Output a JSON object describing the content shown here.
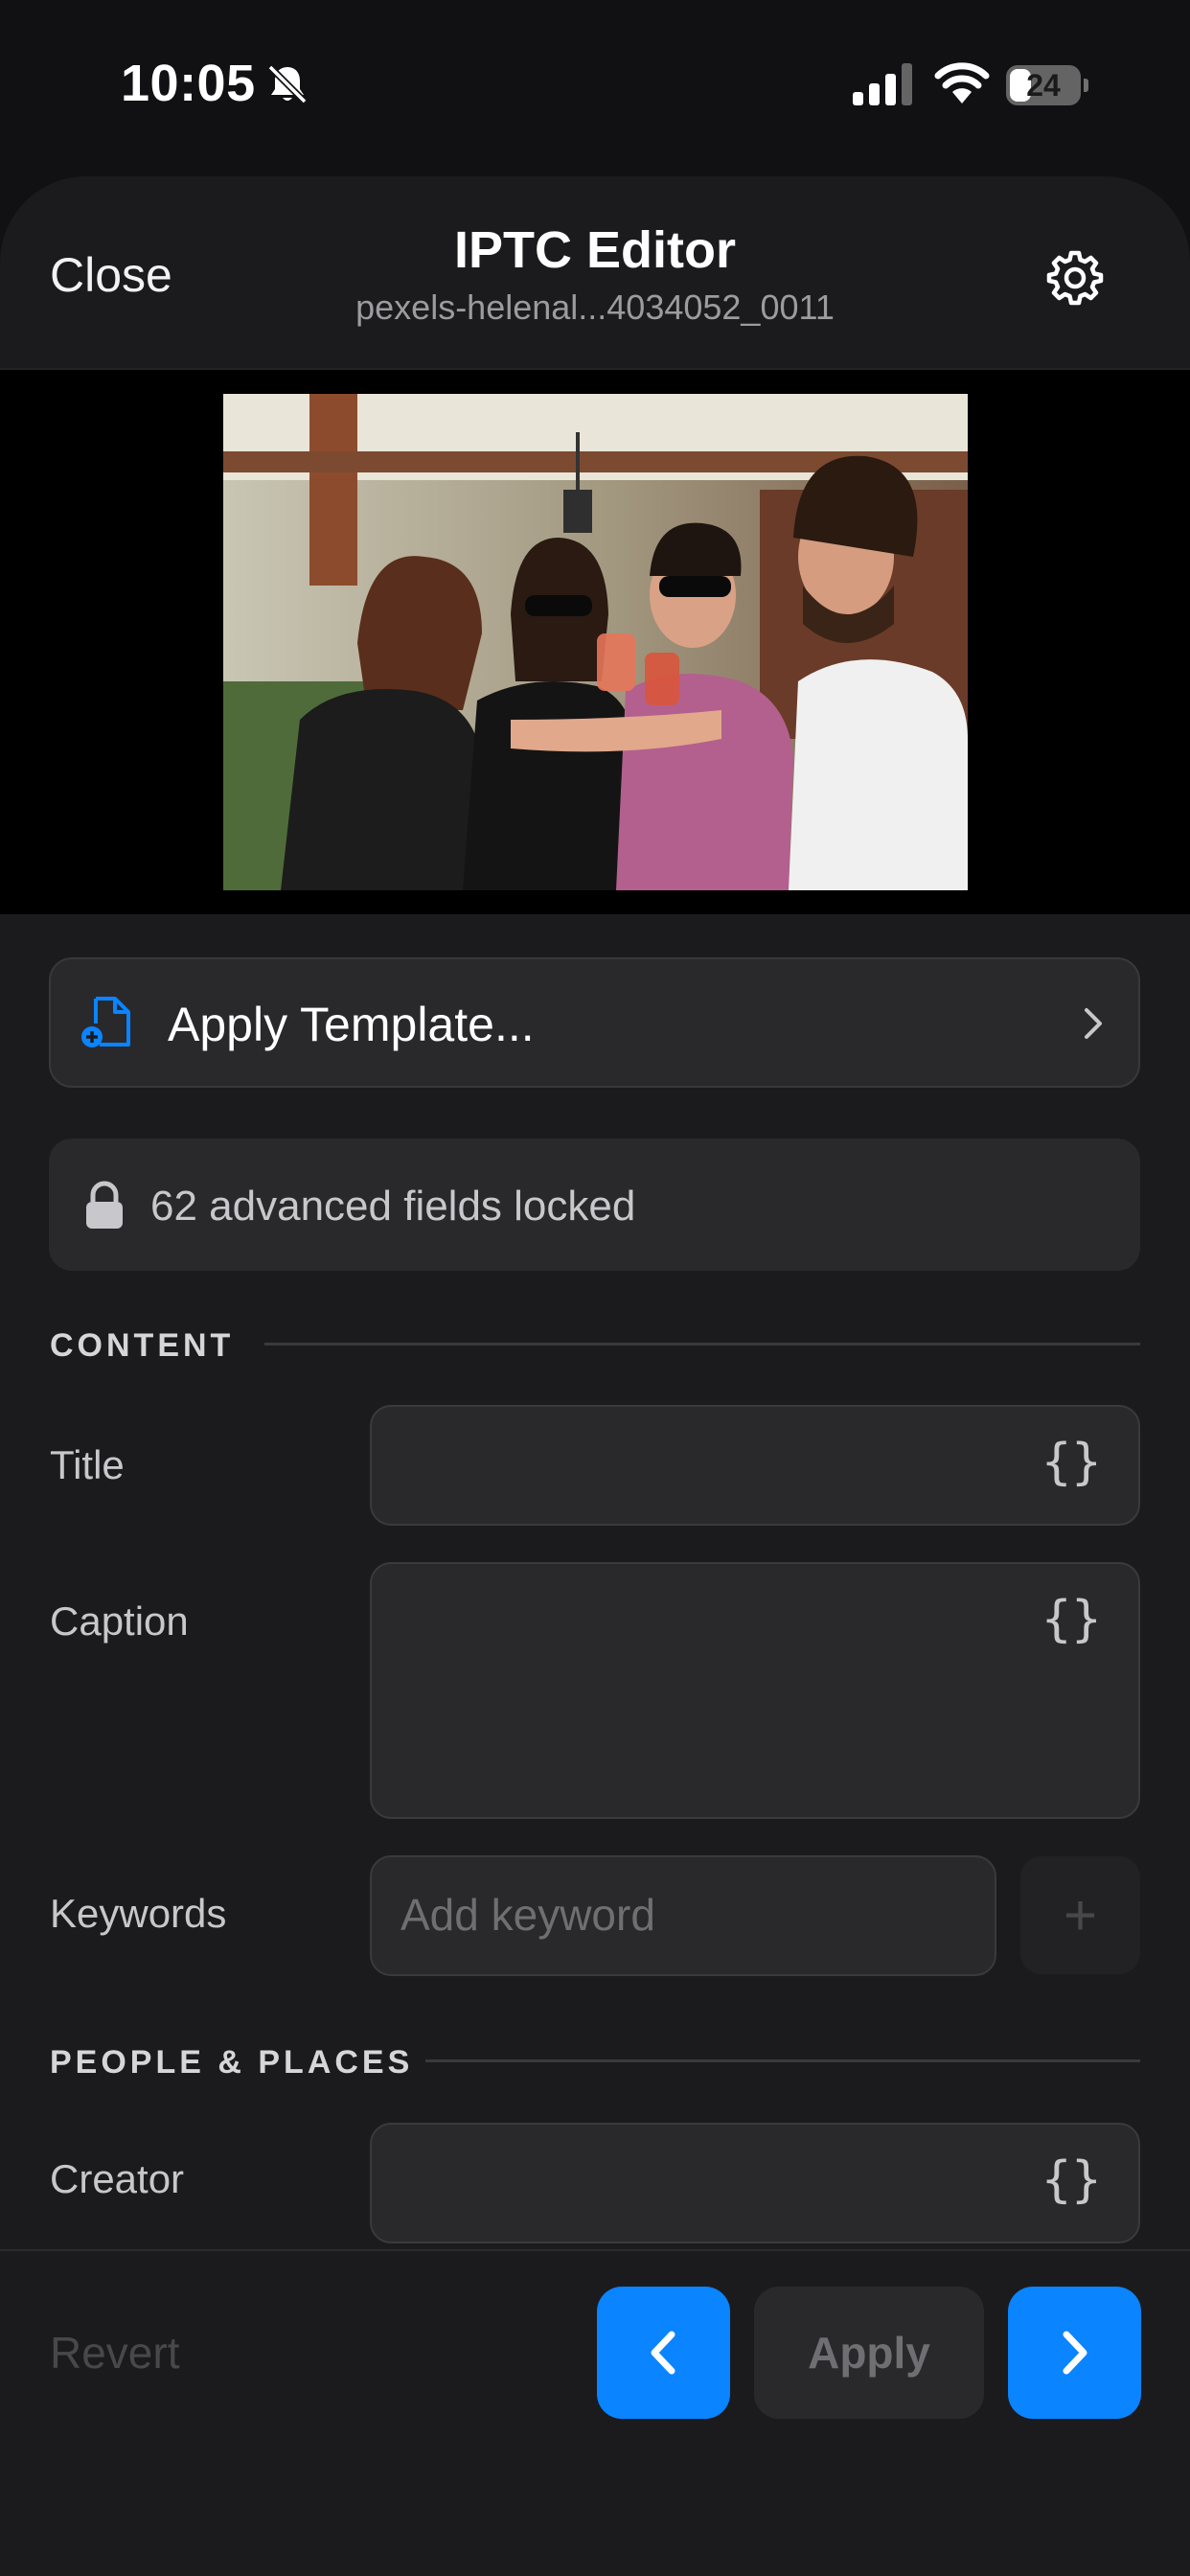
{
  "status_bar": {
    "time": "10:05",
    "battery": "24",
    "icons": [
      "bell-slash-icon",
      "cellular-signal-icon",
      "wifi-icon",
      "battery-icon"
    ]
  },
  "header": {
    "close_label": "Close",
    "title": "IPTC Editor",
    "subtitle": "pexels-helenal...4034052_0011",
    "settings_icon": "gear-icon"
  },
  "template": {
    "label": "Apply Template...",
    "icon": "document-add-icon"
  },
  "locked": {
    "label": "62 advanced fields locked",
    "icon": "lock-icon"
  },
  "sections": {
    "content": "CONTENT",
    "people_places": "PEOPLE & PLACES"
  },
  "fields": {
    "title": {
      "label": "Title",
      "value": ""
    },
    "caption": {
      "label": "Caption",
      "value": ""
    },
    "keywords": {
      "label": "Keywords",
      "placeholder": "Add keyword",
      "add_label": "+"
    },
    "creator": {
      "label": "Creator",
      "value": ""
    },
    "braces": "{}"
  },
  "bottom_bar": {
    "revert_label": "Revert",
    "apply_label": "Apply"
  },
  "colors": {
    "accent": "#0a84ff",
    "background": "#1b1b1d",
    "card": "#29292c"
  }
}
